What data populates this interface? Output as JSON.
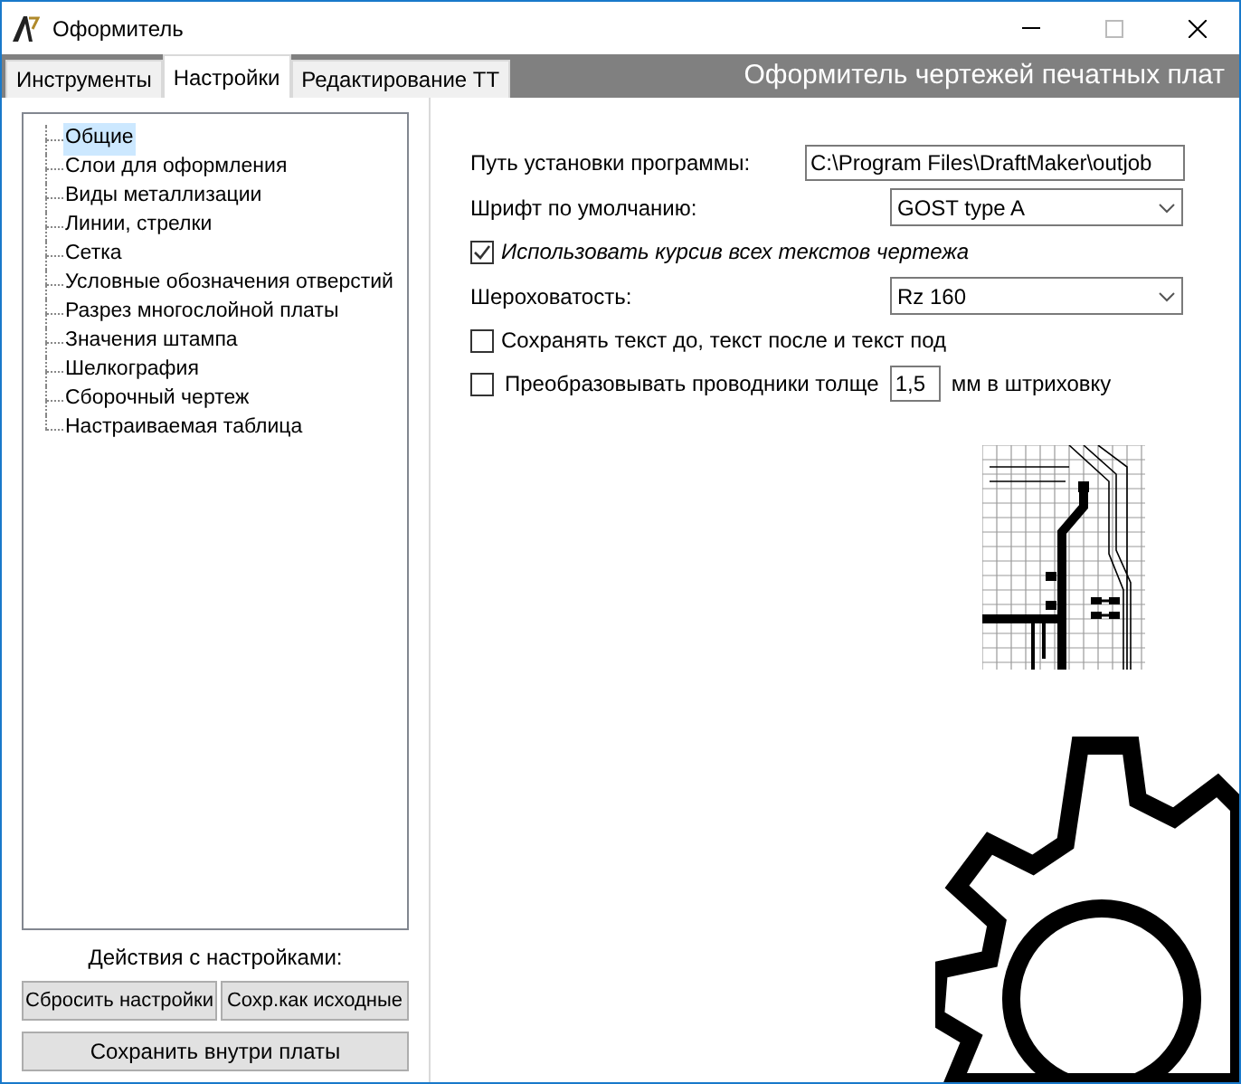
{
  "window": {
    "title": "Оформитель"
  },
  "tabs": [
    {
      "label": "Инструменты",
      "selected": false
    },
    {
      "label": "Настройки",
      "selected": true
    },
    {
      "label": "Редактирование ТТ",
      "selected": false
    }
  ],
  "header_title": "Оформитель чертежей печатных плат",
  "tree": {
    "items": [
      {
        "label": "Общие",
        "selected": true
      },
      {
        "label": "Слои для оформления",
        "selected": false
      },
      {
        "label": "Виды металлизации",
        "selected": false
      },
      {
        "label": "Линии, стрелки",
        "selected": false
      },
      {
        "label": "Сетка",
        "selected": false
      },
      {
        "label": "Условные обозначения отверстий",
        "selected": false
      },
      {
        "label": "Разрез многослойной платы",
        "selected": false
      },
      {
        "label": "Значения штампа",
        "selected": false
      },
      {
        "label": "Шелкография",
        "selected": false
      },
      {
        "label": "Сборочный чертеж",
        "selected": false
      },
      {
        "label": "Настраиваемая таблица",
        "selected": false
      }
    ]
  },
  "actions": {
    "label": "Действия с настройками:",
    "buttons": [
      "Сбросить настройки",
      "Сохр.как исходные"
    ],
    "save_button": "Сохранить внутри платы"
  },
  "settings": [
    {
      "kind": "text",
      "label": "Путь установки программы:",
      "value": "C:\\Program Files\\DraftMaker\\outjob"
    },
    {
      "kind": "dropdown",
      "label": "Шрифт по умолчанию:",
      "value": "GOST type A"
    },
    {
      "kind": "checkbox",
      "label": "Использовать курсив всех текстов чертежа",
      "checked": true,
      "italic": true
    },
    {
      "kind": "dropdown",
      "label": "Шероховатость:",
      "value": "Rz 160"
    },
    {
      "kind": "checkbox",
      "label": "Сохранять текст до, текст после и текст под",
      "checked": false,
      "italic": false
    },
    {
      "kind": "checkbox_field",
      "label": "Преобразовывать проводники толще",
      "value": "1,5",
      "suffix": "мм в штриховку",
      "checked": false
    }
  ]
}
